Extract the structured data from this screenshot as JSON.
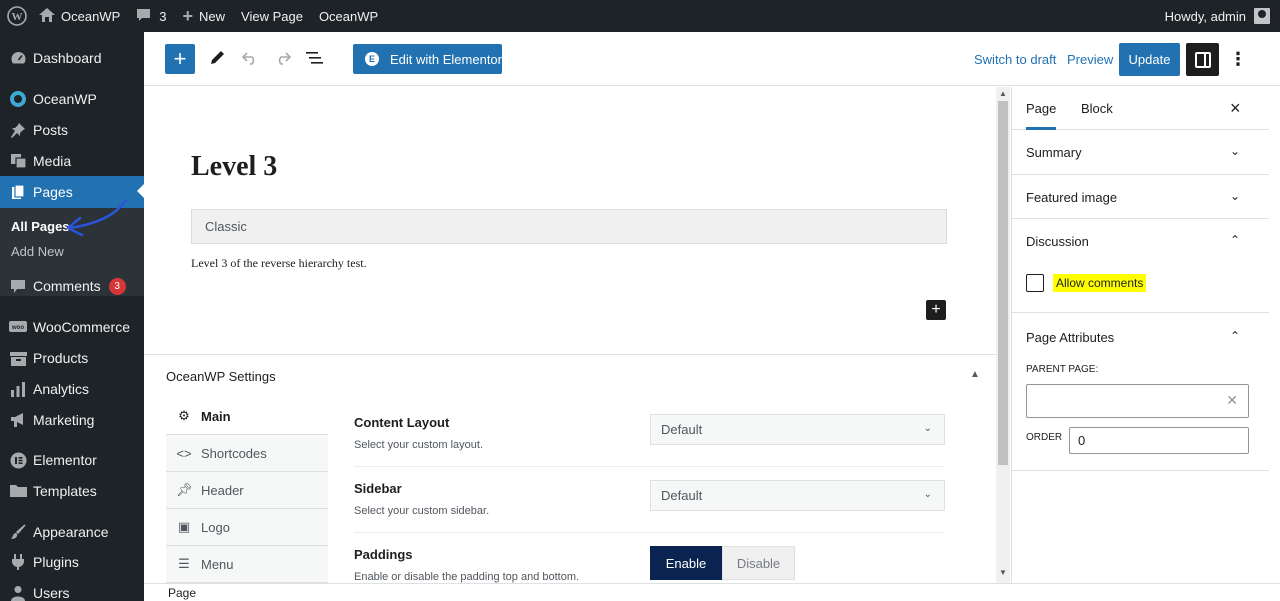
{
  "adminbar": {
    "site_name": "OceanWP",
    "comments_count": "3",
    "new_label": "New",
    "view_page_label": "View Page",
    "theme_label": "OceanWP",
    "howdy": "Howdy, admin"
  },
  "sidebar": {
    "items": [
      {
        "label": "Dashboard",
        "icon": "dashboard-icon"
      },
      {
        "label": "OceanWP",
        "icon": "oceanwp-icon"
      },
      {
        "label": "Posts",
        "icon": "pin-icon"
      },
      {
        "label": "Media",
        "icon": "media-icon"
      },
      {
        "label": "Pages",
        "icon": "pages-icon"
      },
      {
        "label": "Comments",
        "icon": "comment-icon",
        "badge": "3"
      },
      {
        "label": "WooCommerce",
        "icon": "woocommerce-icon"
      },
      {
        "label": "Products",
        "icon": "archive-icon"
      },
      {
        "label": "Analytics",
        "icon": "chart-bar-icon"
      },
      {
        "label": "Marketing",
        "icon": "megaphone-icon"
      },
      {
        "label": "Elementor",
        "icon": "elementor-icon"
      },
      {
        "label": "Templates",
        "icon": "folder-icon"
      },
      {
        "label": "Appearance",
        "icon": "brush-icon"
      },
      {
        "label": "Plugins",
        "icon": "plugin-icon"
      },
      {
        "label": "Users",
        "icon": "user-icon"
      }
    ],
    "submenu": {
      "all_pages": "All Pages",
      "add_new": "Add New"
    }
  },
  "header": {
    "edit_with_elementor": "Edit with Elementor",
    "switch_to_draft": "Switch to draft",
    "preview": "Preview",
    "update": "Update"
  },
  "content": {
    "title": "Level 3",
    "classic_label": "Classic",
    "paragraph": "Level 3 of the reverse hierarchy test."
  },
  "oceanwp_settings": {
    "title": "OceanWP Settings",
    "tabs": [
      {
        "label": "Main",
        "icon": "gear-icon"
      },
      {
        "label": "Shortcodes",
        "icon": "code-icon"
      },
      {
        "label": "Header",
        "icon": "pin-icon"
      },
      {
        "label": "Logo",
        "icon": "image-icon"
      },
      {
        "label": "Menu",
        "icon": "menu-icon"
      }
    ],
    "rows": [
      {
        "label": "Content Layout",
        "desc": "Select your custom layout.",
        "value": "Default"
      },
      {
        "label": "Sidebar",
        "desc": "Select your custom sidebar.",
        "value": "Default"
      },
      {
        "label": "Paddings",
        "desc": "Enable or disable the padding top and bottom.",
        "options": [
          "Enable",
          "Disable"
        ],
        "selected": "Enable"
      }
    ]
  },
  "settings_sidebar": {
    "tab_page": "Page",
    "tab_block": "Block",
    "panels": {
      "summary": "Summary",
      "featured_image": "Featured image",
      "discussion": "Discussion",
      "allow_comments": "Allow comments",
      "page_attributes": "Page Attributes",
      "parent_page_label": "PARENT PAGE:",
      "order_label": "ORDER",
      "order_value": "0"
    }
  },
  "footer": {
    "breadcrumb": "Page"
  },
  "colors": {
    "admin_dark": "#1d2327",
    "accent": "#2271b1",
    "highlight": "#ffff00",
    "enable_active": "#0a2350"
  }
}
